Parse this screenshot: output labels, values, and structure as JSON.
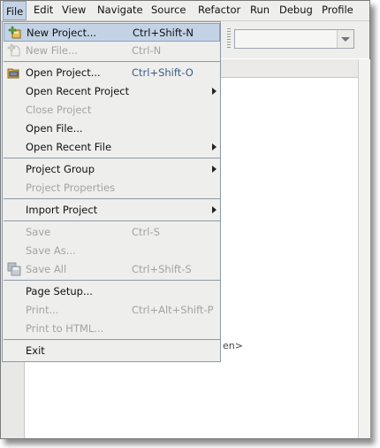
{
  "menubar": {
    "file": "File",
    "edit": "Edit",
    "view": "View",
    "navigate": "Navigate",
    "source": "Source",
    "refactor": "Refactor",
    "run": "Run",
    "debug": "Debug",
    "profile": "Profile"
  },
  "file_menu": {
    "new_project": {
      "label": "New Project...",
      "shortcut": "Ctrl+Shift-N"
    },
    "new_file": {
      "label": "New File...",
      "shortcut": "Ctrl-N"
    },
    "open_project": {
      "label": "Open Project...",
      "shortcut": "Ctrl+Shift-O"
    },
    "open_recent_project": {
      "label": "Open Recent Project"
    },
    "close_project": {
      "label": "Close Project"
    },
    "open_file": {
      "label": "Open File..."
    },
    "open_recent_file": {
      "label": "Open Recent File"
    },
    "project_group": {
      "label": "Project Group"
    },
    "project_properties": {
      "label": "Project Properties"
    },
    "import_project": {
      "label": "Import Project"
    },
    "save": {
      "label": "Save",
      "shortcut": "Ctrl-S"
    },
    "save_as": {
      "label": "Save As..."
    },
    "save_all": {
      "label": "Save All",
      "shortcut": "Ctrl+Shift-S"
    },
    "page_setup": {
      "label": "Page Setup..."
    },
    "print": {
      "label": "Print...",
      "shortcut": "Ctrl+Alt+Shift-P"
    },
    "print_to_html": {
      "label": "Print to HTML..."
    },
    "exit": {
      "label": "Exit"
    }
  },
  "editor": {
    "visible_text": "en>"
  },
  "colors": {
    "menu_bg": "#eeeeec",
    "highlight": "#c3d3e5",
    "highlight_border": "#8aa2c0",
    "separator": "#8e9aa8",
    "disabled_text": "#a3a3a0",
    "accelerator_blue": "#3a5c8c"
  }
}
